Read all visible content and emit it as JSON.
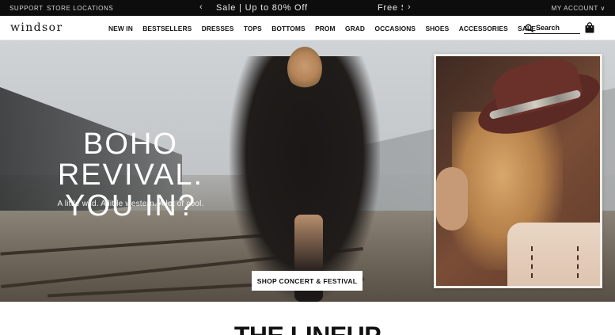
{
  "topbar": {
    "support": "SUPPORT",
    "store_locations": "STORE LOCATIONS",
    "promo_current": "Sale | Up to 80% Off",
    "promo_next": "Free S",
    "account": "MY ACCOUNT ∨"
  },
  "header": {
    "logo": "windsor",
    "nav": [
      "NEW IN",
      "BESTSELLERS",
      "DRESSES",
      "TOPS",
      "BOTTOMS",
      "PROM",
      "GRAD",
      "OCCASIONS",
      "SHOES",
      "ACCESSORIES",
      "SALE"
    ],
    "search_placeholder": "Search",
    "icons": {
      "search": "search-icon",
      "bag": "shopping-bag-icon"
    }
  },
  "hero": {
    "title_line1": "BOHO REVIVAL.",
    "title_line2": "YOU IN?",
    "subtitle": "A little wild. A little western. A lot of cool.",
    "cta": "SHOP CONCERT & FESTIVAL"
  },
  "section": {
    "title": "THE LINEUP"
  },
  "colors": {
    "topbar_bg": "#0d0d0d",
    "text": "#111111",
    "hero_text": "#ffffff",
    "cta_bg": "#ffffff"
  }
}
